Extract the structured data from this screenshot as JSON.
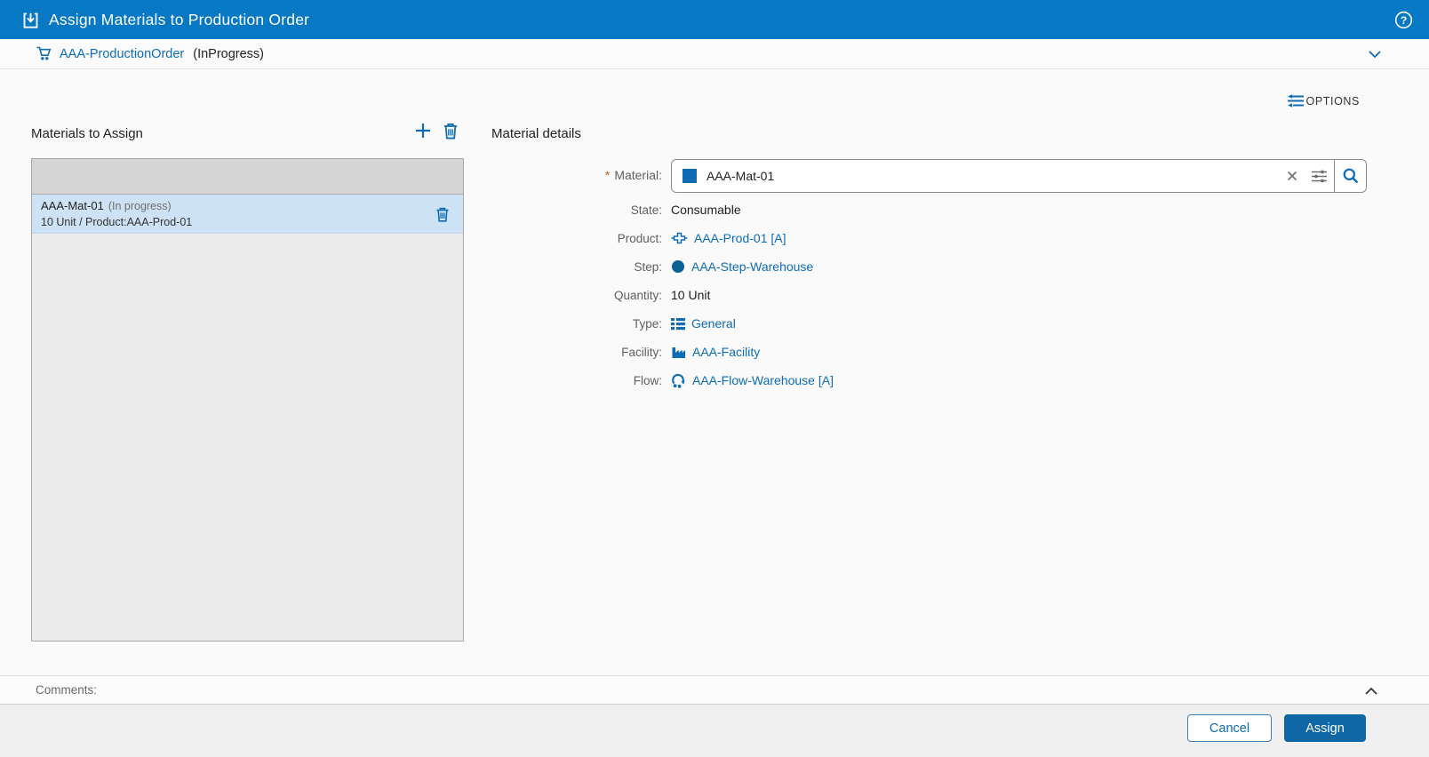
{
  "titlebar": {
    "title": "Assign Materials to Production Order"
  },
  "breadcrumb": {
    "order_name": "AAA-ProductionOrder",
    "order_status": "(InProgress)"
  },
  "options": {
    "label": "OPTIONS"
  },
  "materials_panel": {
    "title": "Materials to Assign",
    "items": [
      {
        "name": "AAA-Mat-01",
        "status": "(In progress)",
        "detail": "10 Unit / Product:AAA-Prod-01",
        "selected": true
      }
    ]
  },
  "details_panel": {
    "title": "Material details",
    "material_field": {
      "required_marker": "*",
      "label": "Material:",
      "value": "AAA-Mat-01"
    },
    "fields": [
      {
        "label": "State:",
        "value": "Consumable"
      },
      {
        "label": "Product:",
        "value": "AAA-Prod-01 [A]"
      },
      {
        "label": "Step:",
        "value": "AAA-Step-Warehouse"
      },
      {
        "label": "Quantity:",
        "value": "10 Unit"
      },
      {
        "label": "Type:",
        "value": "General"
      },
      {
        "label": "Facility:",
        "value": "AAA-Facility"
      },
      {
        "label": "Flow:",
        "value": "AAA-Flow-Warehouse [A]"
      }
    ]
  },
  "comments": {
    "label": "Comments:"
  },
  "footer": {
    "cancel_label": "Cancel",
    "assign_label": "Assign"
  },
  "icons": {
    "assign-materials-icon": "arrow-into-tray",
    "help-icon": "question-mark-circle",
    "cart-icon": "shopping-cart",
    "chevron-down-icon": "chevron-down",
    "chevron-up-icon": "chevron-up",
    "options-icon": "three-lines-with-arrows",
    "add-icon": "plus",
    "delete-icon": "trash-can",
    "material-type-icon": "filled-blue-square",
    "clear-icon": "x-cross",
    "advanced-search-icon": "slider-lines",
    "search-icon": "magnifier",
    "product-icon": "plus-shaped-part",
    "step-icon": "filled-circle",
    "type-icon": "bulleted-list",
    "facility-icon": "factory",
    "flow-icon": "circular-arrow-with-dots"
  },
  "colors": {
    "header_blue": "#0778c4",
    "link_blue": "#0d6cb4",
    "assign_button_blue": "#0f67a6",
    "selected_row_blue": "#cde3f5",
    "list_background": "#ececec",
    "list_header_gray": "#d5d5d5",
    "required_marker_orange": "#c05f1d"
  }
}
